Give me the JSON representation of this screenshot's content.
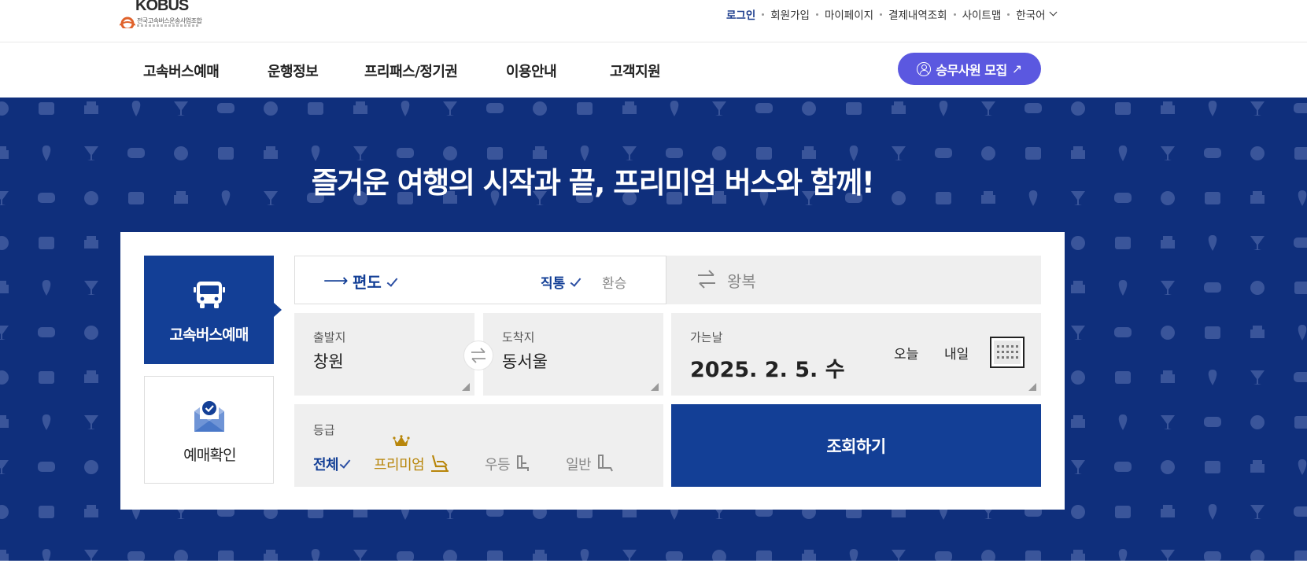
{
  "header": {
    "logo": {
      "text": "KOBUS",
      "subtitle": "전국고속버스운송사업조합"
    },
    "util_links": [
      "로그인",
      "회원가입",
      "마이페이지",
      "결제내역조회",
      "사이트맵",
      "한국어"
    ]
  },
  "nav": {
    "items": [
      "고속버스예매",
      "운행정보",
      "프리패스/정기권",
      "이용안내",
      "고객지원"
    ],
    "recruit_label": "승무사원 모집"
  },
  "hero": {
    "headline": "즐거운 여행의 시작과 끝, 프리미엄 버스와 함께!"
  },
  "booking": {
    "tabs": {
      "book_label": "고속버스예매",
      "check_label": "예매확인"
    },
    "trip": {
      "oneway_label": "편도",
      "direct_label": "직통",
      "transfer_label": "환승",
      "round_label": "왕복"
    },
    "departure": {
      "caption": "출발지",
      "value": "창원"
    },
    "arrival": {
      "caption": "도착지",
      "value": "동서울"
    },
    "date": {
      "caption": "가는날",
      "value": "2025. 2. 5. 수",
      "today_label": "오늘",
      "tomorrow_label": "내일"
    },
    "grade": {
      "caption": "등급",
      "options": [
        "전체",
        "프리미엄",
        "우등",
        "일반"
      ]
    },
    "search_label": "조회하기"
  },
  "colors": {
    "brand_blue": "#133f96",
    "hero_bg": "#0f2f7c",
    "recruit_purple": "#5b58e0",
    "premium_gold": "#b8860b"
  }
}
